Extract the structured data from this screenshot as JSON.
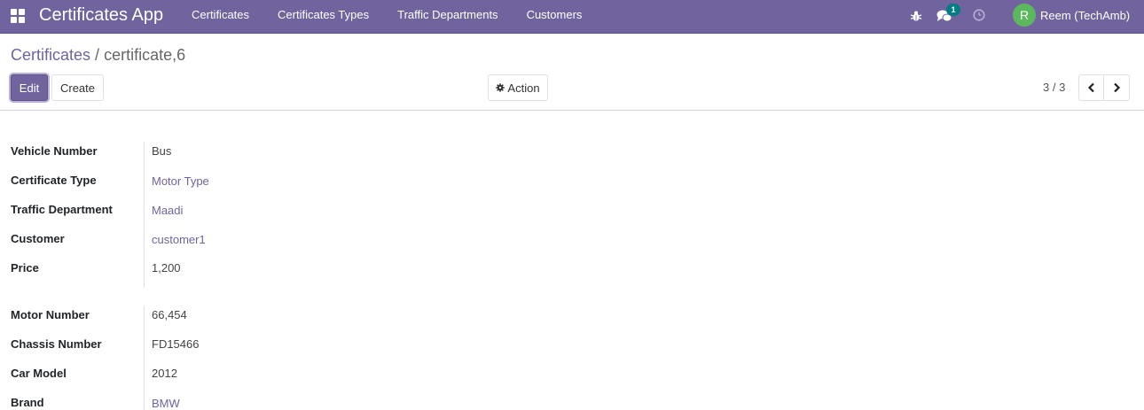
{
  "navbar": {
    "app_name": "Certificates App",
    "menu": [
      "Certificates",
      "Certificates Types",
      "Traffic Departments",
      "Customers"
    ],
    "chat_badge": "1",
    "user_initial": "R",
    "user_name": "Reem (TechAmb)",
    "icons": [
      "apps-icon",
      "bug-icon",
      "chat-icon",
      "clock-icon"
    ]
  },
  "breadcrumb": {
    "parent": "Certificates",
    "separator": "/",
    "current": "certificate,6"
  },
  "buttons": {
    "edit": "Edit",
    "create": "Create",
    "action": "Action"
  },
  "pager": {
    "value": "3 / 3"
  },
  "form": {
    "group1": [
      {
        "label": "Vehicle Number",
        "value": "Bus"
      },
      {
        "label": "Certificate Type",
        "value": "Motor Type"
      },
      {
        "label": "Traffic Department",
        "value": "Maadi"
      },
      {
        "label": "Customer",
        "value": "customer1"
      },
      {
        "label": "Price",
        "value": "1,200"
      }
    ],
    "group2": [
      {
        "label": "Motor Number",
        "value": "66,454"
      },
      {
        "label": "Chassis Number",
        "value": "FD15466"
      },
      {
        "label": "Car Model",
        "value": "2012"
      },
      {
        "label": "Brand",
        "value": "BMW"
      }
    ]
  },
  "colors": {
    "primary": "#71639e",
    "avatar": "#5cb85c",
    "badge": "#017e84"
  }
}
